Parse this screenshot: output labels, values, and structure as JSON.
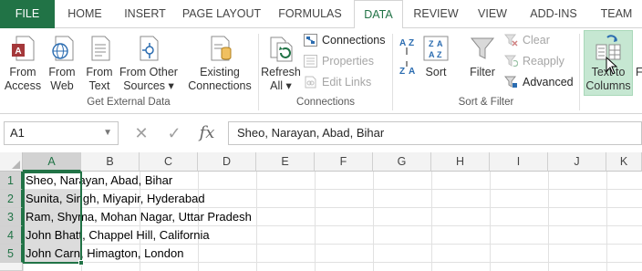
{
  "tabs": [
    {
      "label": "FILE"
    },
    {
      "label": "HOME"
    },
    {
      "label": "INSERT"
    },
    {
      "label": "PAGE LAYOUT"
    },
    {
      "label": "FORMULAS"
    },
    {
      "label": "DATA"
    },
    {
      "label": "REVIEW"
    },
    {
      "label": "VIEW"
    },
    {
      "label": "ADD-INS"
    },
    {
      "label": "TEAM"
    }
  ],
  "active_tab": "DATA",
  "ribbon": {
    "get_external": {
      "label": "Get External Data",
      "from_access": {
        "line1": "From",
        "line2": "Access"
      },
      "from_web": {
        "line1": "From",
        "line2": "Web"
      },
      "from_text": {
        "line1": "From",
        "line2": "Text"
      },
      "from_other": {
        "line1": "From Other",
        "line2": "Sources ▾"
      },
      "existing": {
        "line1": "Existing",
        "line2": "Connections"
      }
    },
    "connections": {
      "label": "Connections",
      "refresh": {
        "line1": "Refresh",
        "line2": "All ▾"
      },
      "connections": "Connections",
      "properties": "Properties",
      "edit_links": "Edit Links"
    },
    "sort_filter": {
      "label": "Sort & Filter",
      "sort": "Sort",
      "filter": "Filter",
      "clear": "Clear",
      "reapply": "Reapply",
      "advanced": "Advanced"
    },
    "data_tools": {
      "text_to_columns": {
        "line1": "Text to",
        "line2": "Columns"
      },
      "next_partial": "F"
    }
  },
  "formula_bar": {
    "name_box": "A1",
    "cancel_icon": "✕",
    "enter_icon": "✓",
    "fx": "fx",
    "formula": "Sheo, Narayan, Abad, Bihar"
  },
  "grid": {
    "columns": [
      "A",
      "B",
      "C",
      "D",
      "E",
      "F",
      "G",
      "H",
      "I",
      "J",
      "K"
    ],
    "rows": [
      "1",
      "2",
      "3",
      "4",
      "5"
    ],
    "cells": [
      "Sheo, Narayan, Abad, Bihar",
      "Sunita, Singh, Miyapir, Hyderabad",
      "Ram, Shyma, Mohan Nagar, Uttar Pradesh",
      "John Bhatt, Chappel Hill, California",
      "John Carn, Himagton, London"
    ],
    "selected_range": "A1:A5"
  },
  "colors": {
    "accent": "#217346",
    "selection_fill": "#dcdcdc",
    "ribbon_highlight": "#c6e7d2"
  }
}
